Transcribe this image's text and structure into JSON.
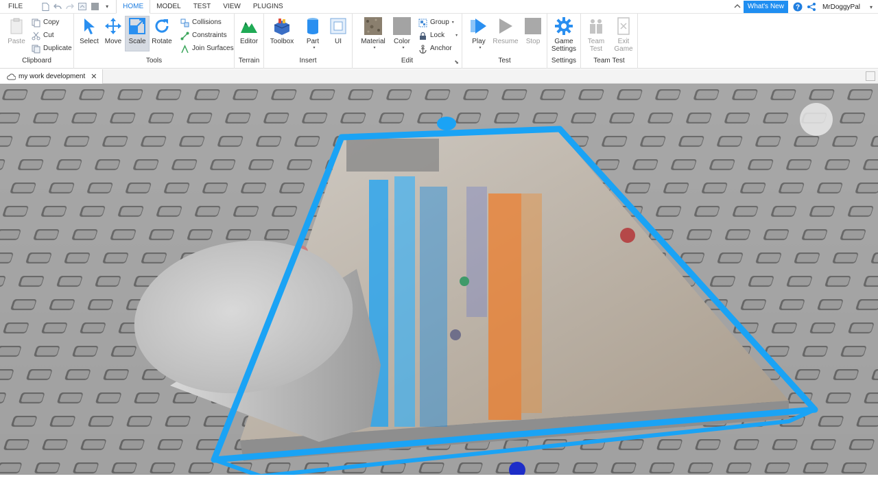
{
  "menubar": {
    "file": "FILE",
    "tabs": [
      {
        "label": "HOME",
        "active": true
      },
      {
        "label": "MODEL",
        "active": false
      },
      {
        "label": "TEST",
        "active": false
      },
      {
        "label": "VIEW",
        "active": false
      },
      {
        "label": "PLUGINS",
        "active": false
      }
    ],
    "whats_new": "What's New",
    "user_name": "MrDoggyPal"
  },
  "ribbon": {
    "clipboard": {
      "label": "Clipboard",
      "paste": "Paste",
      "copy": "Copy",
      "cut": "Cut",
      "duplicate": "Duplicate"
    },
    "tools": {
      "label": "Tools",
      "select": "Select",
      "move": "Move",
      "scale": "Scale",
      "rotate": "Rotate",
      "collisions": "Collisions",
      "constraints": "Constraints",
      "join_surfaces": "Join Surfaces"
    },
    "terrain": {
      "label": "Terrain",
      "editor": "Editor"
    },
    "insert": {
      "label": "Insert",
      "toolbox": "Toolbox",
      "part": "Part",
      "ui": "UI"
    },
    "edit": {
      "label": "Edit",
      "material": "Material",
      "color": "Color",
      "group": "Group",
      "lock": "Lock",
      "anchor": "Anchor"
    },
    "test": {
      "label": "Test",
      "play": "Play",
      "resume": "Resume",
      "stop": "Stop"
    },
    "settings": {
      "label": "Settings",
      "game_settings_1": "Game",
      "game_settings_2": "Settings"
    },
    "team_test": {
      "label": "Team Test",
      "team_test_1": "Team",
      "team_test_2": "Test",
      "exit_game_1": "Exit",
      "exit_game_2": "Game"
    }
  },
  "document": {
    "tab_title": "my work development"
  },
  "colors": {
    "accent": "#1f8ef1",
    "selection": "#1aa3f5",
    "baseplate": "#9c9c9c"
  }
}
